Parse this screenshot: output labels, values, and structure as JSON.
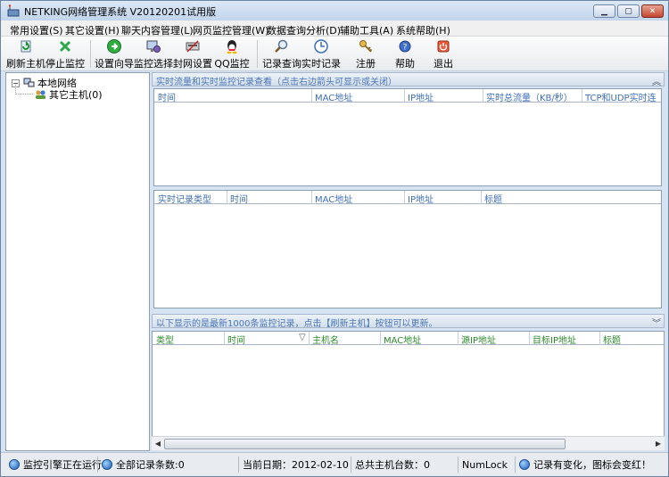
{
  "window": {
    "title": "NETKING网络管理系统 V20120201试用版",
    "controls": [
      "minimize",
      "maximize",
      "close"
    ]
  },
  "menu": [
    "常用设置(S)",
    "其它设置(H)",
    "聊天内容管理(L)",
    "网页监控管理(W)",
    "数据查询分析(D)",
    "辅助工具(A)",
    "系统帮助(H)"
  ],
  "toolbar": [
    {
      "label": "刷新主机",
      "icon": "refresh-icon"
    },
    {
      "label": "停止监控",
      "icon": "stop-icon"
    },
    {
      "label": "设置向导",
      "icon": "wizard-icon"
    },
    {
      "label": "监控选择",
      "icon": "monitor-select-icon"
    },
    {
      "label": "封网设置",
      "icon": "block-network-icon"
    },
    {
      "label": "QQ监控",
      "icon": "qq-icon"
    },
    {
      "label": "记录查询",
      "icon": "search-icon"
    },
    {
      "label": "实时记录",
      "icon": "clock-icon"
    },
    {
      "label": "注册",
      "icon": "key-icon"
    },
    {
      "label": "帮助",
      "icon": "help-icon"
    },
    {
      "label": "退出",
      "icon": "exit-icon"
    }
  ],
  "tree": {
    "root": "本地网络",
    "children": [
      "其它主机(0)"
    ]
  },
  "realtime_panel": {
    "header": "实时流量和实时监控记录查看（点击右边箭头可显示或关闭）",
    "traffic_columns": [
      "时间",
      "MAC地址",
      "IP地址",
      "实时总流量（KB/秒）",
      "TCP和UDP实时连"
    ],
    "record_columns": [
      "实时记录类型",
      "时间",
      "MAC地址",
      "IP地址",
      "标题"
    ]
  },
  "log_panel": {
    "header": "以下显示的是最新1000条监控记录，点击【刷新主机】按钮可以更新。",
    "columns": [
      "类型",
      "时间",
      "主机名",
      "MAC地址",
      "源IP地址",
      "目标IP地址",
      "标题"
    ],
    "sort_indicator": "▽"
  },
  "status": {
    "engine": "监控引擎正在运行",
    "total_records": "全部记录条数:0",
    "date": "当前日期：2012-02-10",
    "host_count": "总共主机台数：0",
    "numlock": "NumLock",
    "hint": "记录有变化，图标会变红！"
  }
}
